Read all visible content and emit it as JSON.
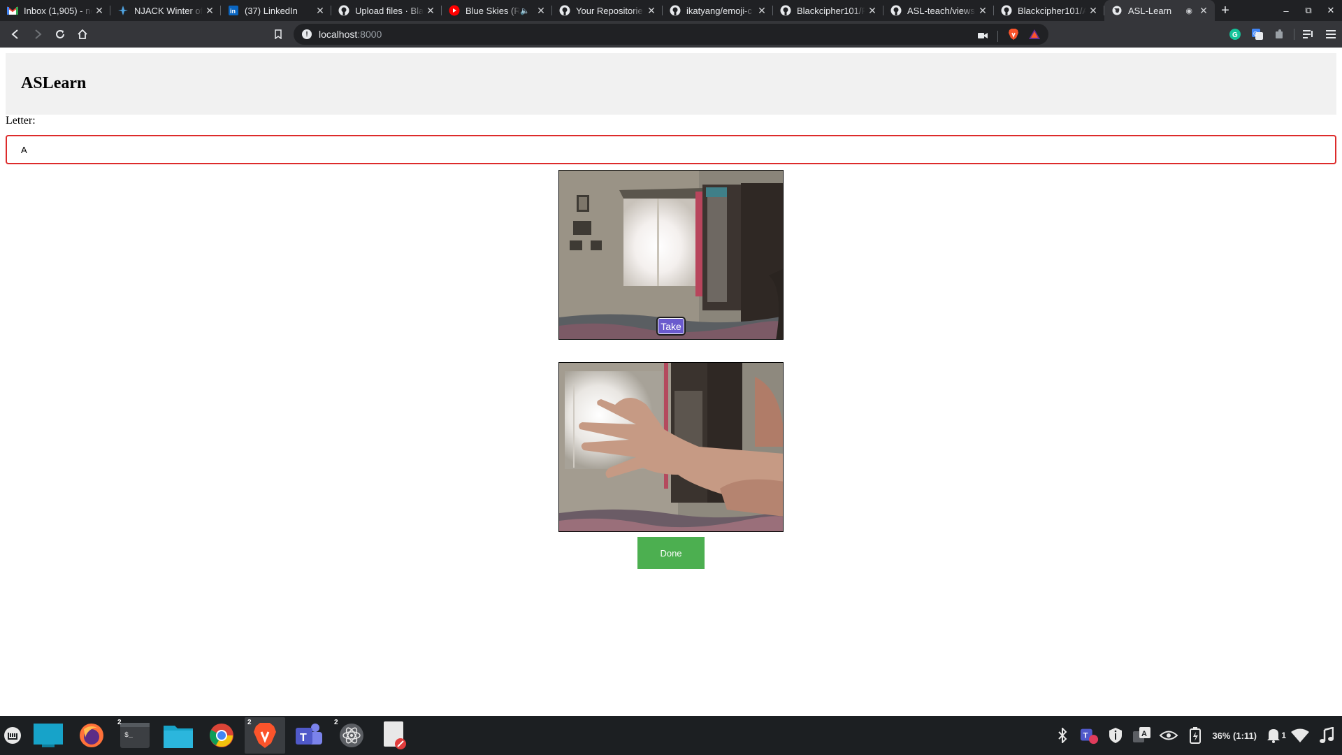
{
  "browser": {
    "tabs": [
      {
        "title": "Inbox (1,905) - ne",
        "favicon": "gmail-icon",
        "color": "#ea4335"
      },
      {
        "title": "NJACK Winter of",
        "favicon": "njack-icon",
        "color": "#4fa3e0"
      },
      {
        "title": "(37) LinkedIn",
        "favicon": "linkedin-icon",
        "color": "#0a66c2"
      },
      {
        "title": "Upload files · Bla",
        "favicon": "github-icon",
        "color": "#e8eaed"
      },
      {
        "title": "Blue Skies (Re",
        "favicon": "youtube-icon",
        "color": "#ff0000",
        "audio": "🔈"
      },
      {
        "title": "Your Repositorie",
        "favicon": "github-icon",
        "color": "#e8eaed"
      },
      {
        "title": "ikatyang/emoji-c",
        "favicon": "github-icon",
        "color": "#e8eaed"
      },
      {
        "title": "Blackcipher101/R",
        "favicon": "github-icon",
        "color": "#e8eaed"
      },
      {
        "title": "ASL-teach/views",
        "favicon": "github-icon",
        "color": "#e8eaed"
      },
      {
        "title": "Blackcipher101/A",
        "favicon": "github-icon",
        "color": "#e8eaed"
      },
      {
        "title": "ASL-Learn",
        "favicon": "globe-icon",
        "color": "#e8eaed",
        "active": true,
        "recording": true
      }
    ],
    "new_tab_symbol": "+",
    "window_controls": {
      "minimize": "–",
      "restore": "⧉",
      "close": "✕"
    },
    "address": {
      "host": "localhost",
      "port": ":8000"
    }
  },
  "page": {
    "app_title": "ASLearn",
    "letter_label": "Letter:",
    "letter_value": "A",
    "take_label": "Take",
    "done_label": "Done"
  },
  "taskbar": {
    "apps": [
      {
        "name": "mint-menu-icon"
      },
      {
        "name": "show-desktop-icon"
      },
      {
        "name": "firefox-icon"
      },
      {
        "name": "terminal-icon",
        "badge": "2"
      },
      {
        "name": "files-icon"
      },
      {
        "name": "chrome-icon"
      },
      {
        "name": "brave-icon",
        "badge": "2",
        "active": true
      },
      {
        "name": "teams-icon"
      },
      {
        "name": "atom-icon",
        "badge": "2"
      },
      {
        "name": "text-editor-icon"
      }
    ],
    "tray": {
      "battery": "36% (1:11)",
      "notifications": "1"
    }
  },
  "colors": {
    "accent_take": "#6a5acd",
    "accent_done": "#4caf50",
    "input_border": "#dd2b2b",
    "header_bg": "#f1f1f1"
  }
}
